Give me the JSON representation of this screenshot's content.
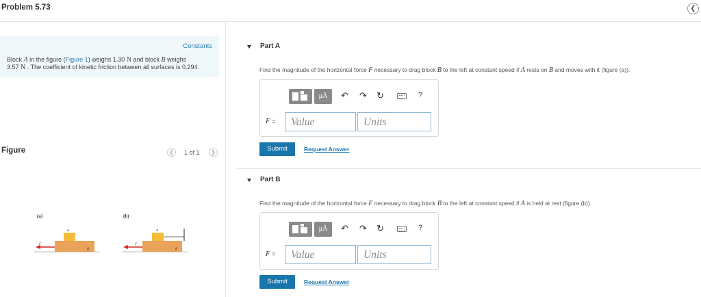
{
  "header": {
    "title": "Problem 5.73",
    "back_icon": "chevron-left-icon"
  },
  "context": {
    "constants_link": "Constants",
    "line1_pre": "Block ",
    "block_a": "A",
    "line1_mid": " in the figure (",
    "figure_link": "Figure 1",
    "line1_post": ") weighs 1.30 ",
    "unit_n": "N",
    "line1_mid2": " and block ",
    "block_b": "B",
    "line1_end": " weighs",
    "line2_pre": "3.57 ",
    "unit_n2": "N",
    "line2_post": " . The coefficient of kinetic friction between all surfaces is 0.294."
  },
  "figure": {
    "label": "Figure",
    "pager_text": "1 of 1",
    "sub_a": "(a)",
    "sub_b": "(b)",
    "block_a_label": "A",
    "block_b_label": "B",
    "force_label": "F"
  },
  "parts": [
    {
      "title": "Part A",
      "prompt_pre": "Find the magnitude of the horizontal force ",
      "force": "F",
      "prompt_mid": " necessary to drag block ",
      "block_b": "B",
      "prompt_mid2": " to the left at constant speed if ",
      "block_a": "A",
      "prompt_mid3": " rests on ",
      "block_b2": "B",
      "prompt_end": " and moves with it (figure (a)).",
      "mu_label": "μÅ",
      "help_label": "?",
      "f_label": "F",
      "f_eq": " =",
      "value_placeholder": "Value",
      "units_placeholder": "Units",
      "submit": "Submit",
      "request": "Request Answer"
    },
    {
      "title": "Part B",
      "prompt_pre": "Find the magnitude of the horizontal force ",
      "force": "F",
      "prompt_mid": " necessary to drag block ",
      "block_b": "B",
      "prompt_mid2": " to the left at constant speed if ",
      "block_a": "A",
      "prompt_end": " is held at rest (figure (b)).",
      "mu_label": "μÅ",
      "help_label": "?",
      "f_label": "F",
      "f_eq": " =",
      "value_placeholder": "Value",
      "units_placeholder": "Units",
      "submit": "Submit",
      "request": "Request Answer"
    }
  ],
  "colors": {
    "accent": "#1976ad",
    "block": "#e9a35a",
    "arrow": "#d8232a",
    "context_bg": "#eef7f9"
  }
}
